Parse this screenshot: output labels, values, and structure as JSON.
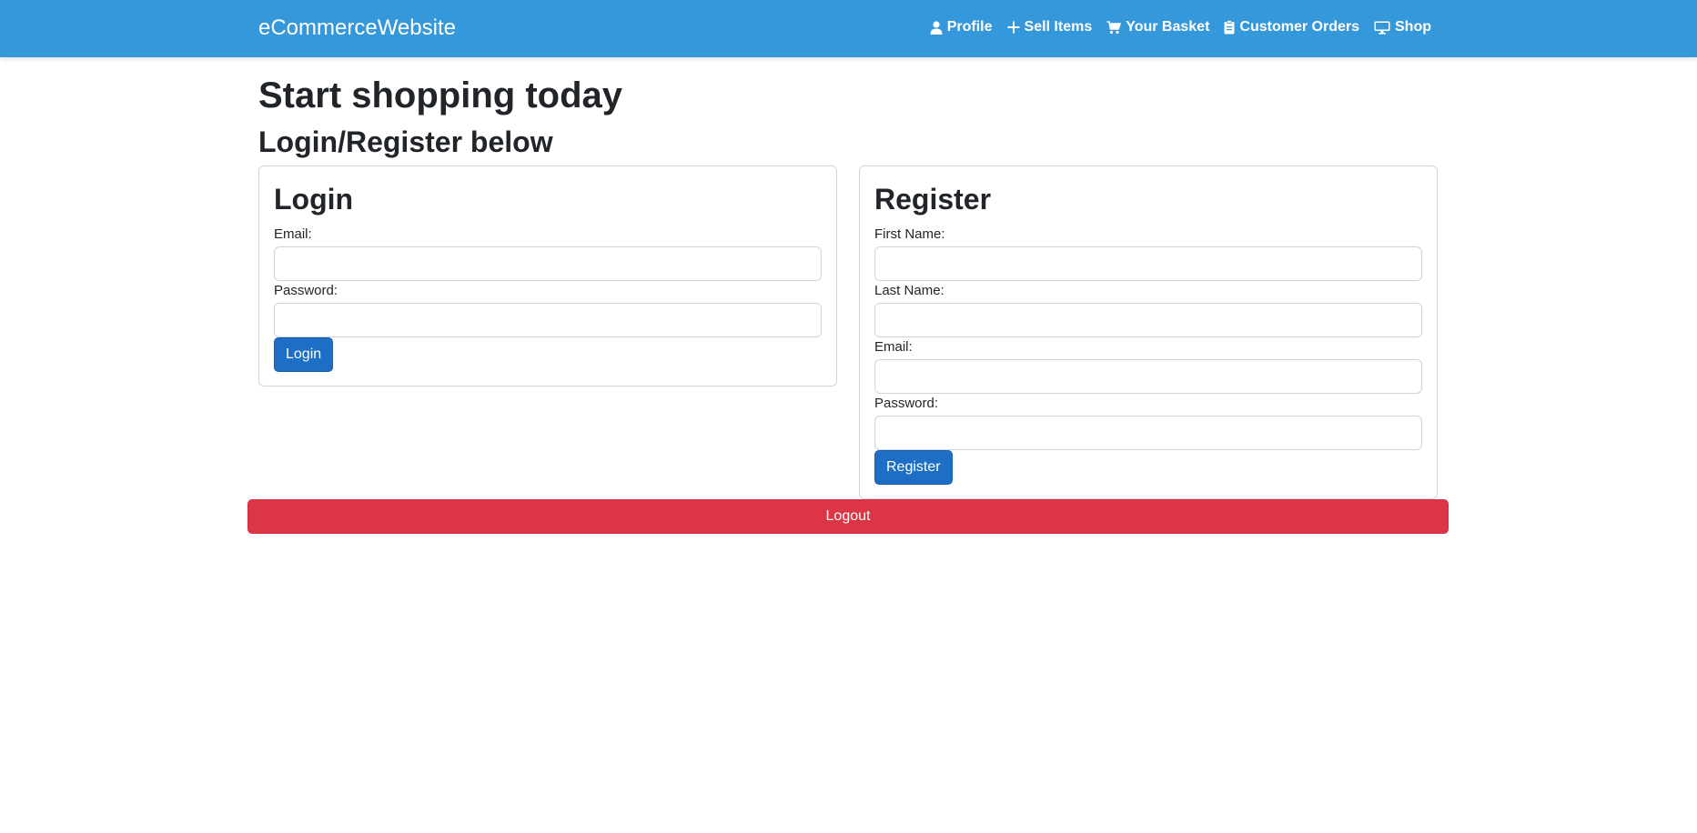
{
  "navbar": {
    "brand": "eCommerceWebsite",
    "links": [
      {
        "label": "Profile",
        "icon": "person-icon"
      },
      {
        "label": "Sell Items",
        "icon": "plus-icon"
      },
      {
        "label": "Your Basket",
        "icon": "cart-icon"
      },
      {
        "label": "Customer Orders",
        "icon": "clipboard-icon"
      },
      {
        "label": "Shop",
        "icon": "monitor-icon"
      }
    ],
    "colors": {
      "background": "#3598db",
      "text": "#ffffff"
    }
  },
  "main": {
    "title": "Start shopping today",
    "subtitle": "Login/Register below"
  },
  "login": {
    "title": "Login",
    "email_label": "Email:",
    "email_value": "",
    "password_label": "Password:",
    "password_value": "",
    "button_label": "Login"
  },
  "register": {
    "title": "Register",
    "first_name_label": "First Name:",
    "first_name_value": "",
    "last_name_label": "Last Name:",
    "last_name_value": "",
    "email_label": "Email:",
    "email_value": "",
    "password_label": "Password:",
    "password_value": "",
    "button_label": "Register"
  },
  "logout": {
    "button_label": "Logout"
  },
  "colors": {
    "primary_button": "#1c6fc5",
    "danger_button": "#dc3545"
  }
}
